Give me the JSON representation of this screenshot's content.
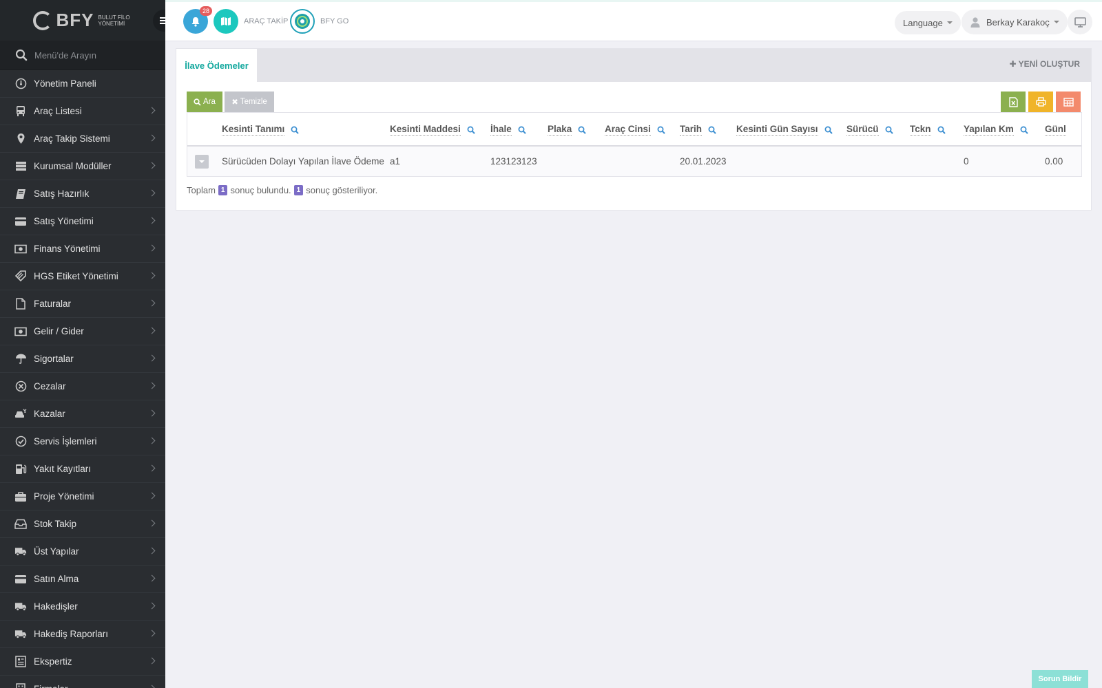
{
  "brand": {
    "logo_text": "BFY",
    "logo_sub_line1": "BULUT FİLO",
    "logo_sub_line2": "YÖNETİMİ"
  },
  "sidebar": {
    "search_placeholder": "Menü'de Arayın",
    "items": [
      {
        "label": "Yönetim Paneli",
        "icon": "dashboard-icon"
      },
      {
        "label": "Araç Listesi",
        "icon": "bus-icon"
      },
      {
        "label": "Araç Takip Sistemi",
        "icon": "map-marker-icon"
      },
      {
        "label": "Kurumsal Modüller",
        "icon": "server-icon"
      },
      {
        "label": "Satış Hazırlık",
        "icon": "book-icon"
      },
      {
        "label": "Satış Yönetimi",
        "icon": "credit-card-icon"
      },
      {
        "label": "Finans Yönetimi",
        "icon": "money-icon"
      },
      {
        "label": "HGS Etiket Yönetimi",
        "icon": "tag-icon"
      },
      {
        "label": "Faturalar",
        "icon": "file-icon"
      },
      {
        "label": "Gelir / Gider",
        "icon": "money-icon"
      },
      {
        "label": "Sigortalar",
        "icon": "umbrella-icon"
      },
      {
        "label": "Cezalar",
        "icon": "times-circle-icon"
      },
      {
        "label": "Kazalar",
        "icon": "car-crash-icon"
      },
      {
        "label": "Servis İşlemleri",
        "icon": "check-circle-icon"
      },
      {
        "label": "Yakıt Kayıtları",
        "icon": "fuel-icon"
      },
      {
        "label": "Proje Yönetimi",
        "icon": "briefcase-icon"
      },
      {
        "label": "Stok Takip",
        "icon": "inbox-icon"
      },
      {
        "label": "Üst Yapılar",
        "icon": "truck-icon"
      },
      {
        "label": "Satın Alma",
        "icon": "credit-card-icon"
      },
      {
        "label": "Hakedişler",
        "icon": "truck-icon"
      },
      {
        "label": "Hakediş Raporları",
        "icon": "truck-icon"
      },
      {
        "label": "Ekspertiz",
        "icon": "report-icon"
      },
      {
        "label": "Firmalar",
        "icon": "building-icon"
      }
    ]
  },
  "topbar": {
    "notification_count": "28",
    "arac_takip_label": "ARAÇ TAKİP",
    "bfy_go_label": "BFY GO",
    "language_label": "Language",
    "user_name": "Berkay Karakoç"
  },
  "panel": {
    "tab_label": "İlave Ödemeler",
    "new_button_label": "YENİ OLUŞTUR",
    "search_button_label": "Ara",
    "clear_button_label": "Temizle"
  },
  "grid": {
    "columns": [
      "Kesinti Tanımı",
      "Kesinti Maddesi",
      "İhale",
      "Plaka",
      "Araç Cinsi",
      "Tarih",
      "Kesinti Gün Sayısı",
      "Sürücü",
      "Tckn",
      "Yapılan Km",
      "Günl"
    ],
    "rows": [
      [
        "Sürücüden Dolayı Yapılan İlave Ödeme",
        "a1",
        "123123123",
        "",
        "",
        "20.01.2023",
        "",
        "",
        "",
        "0",
        "0.00"
      ]
    ]
  },
  "summary": {
    "prefix": "Toplam",
    "total": "1",
    "middle": "sonuç bulundu.",
    "shown": "1",
    "suffix": "sonuç gösteriliyor."
  },
  "report_button_label": "Sorun Bildir",
  "colors": {
    "accent": "#13a89e",
    "green": "#8bb04f",
    "yellow": "#f0b429",
    "orange": "#f38a6c",
    "badge": "#7b6cc6"
  }
}
